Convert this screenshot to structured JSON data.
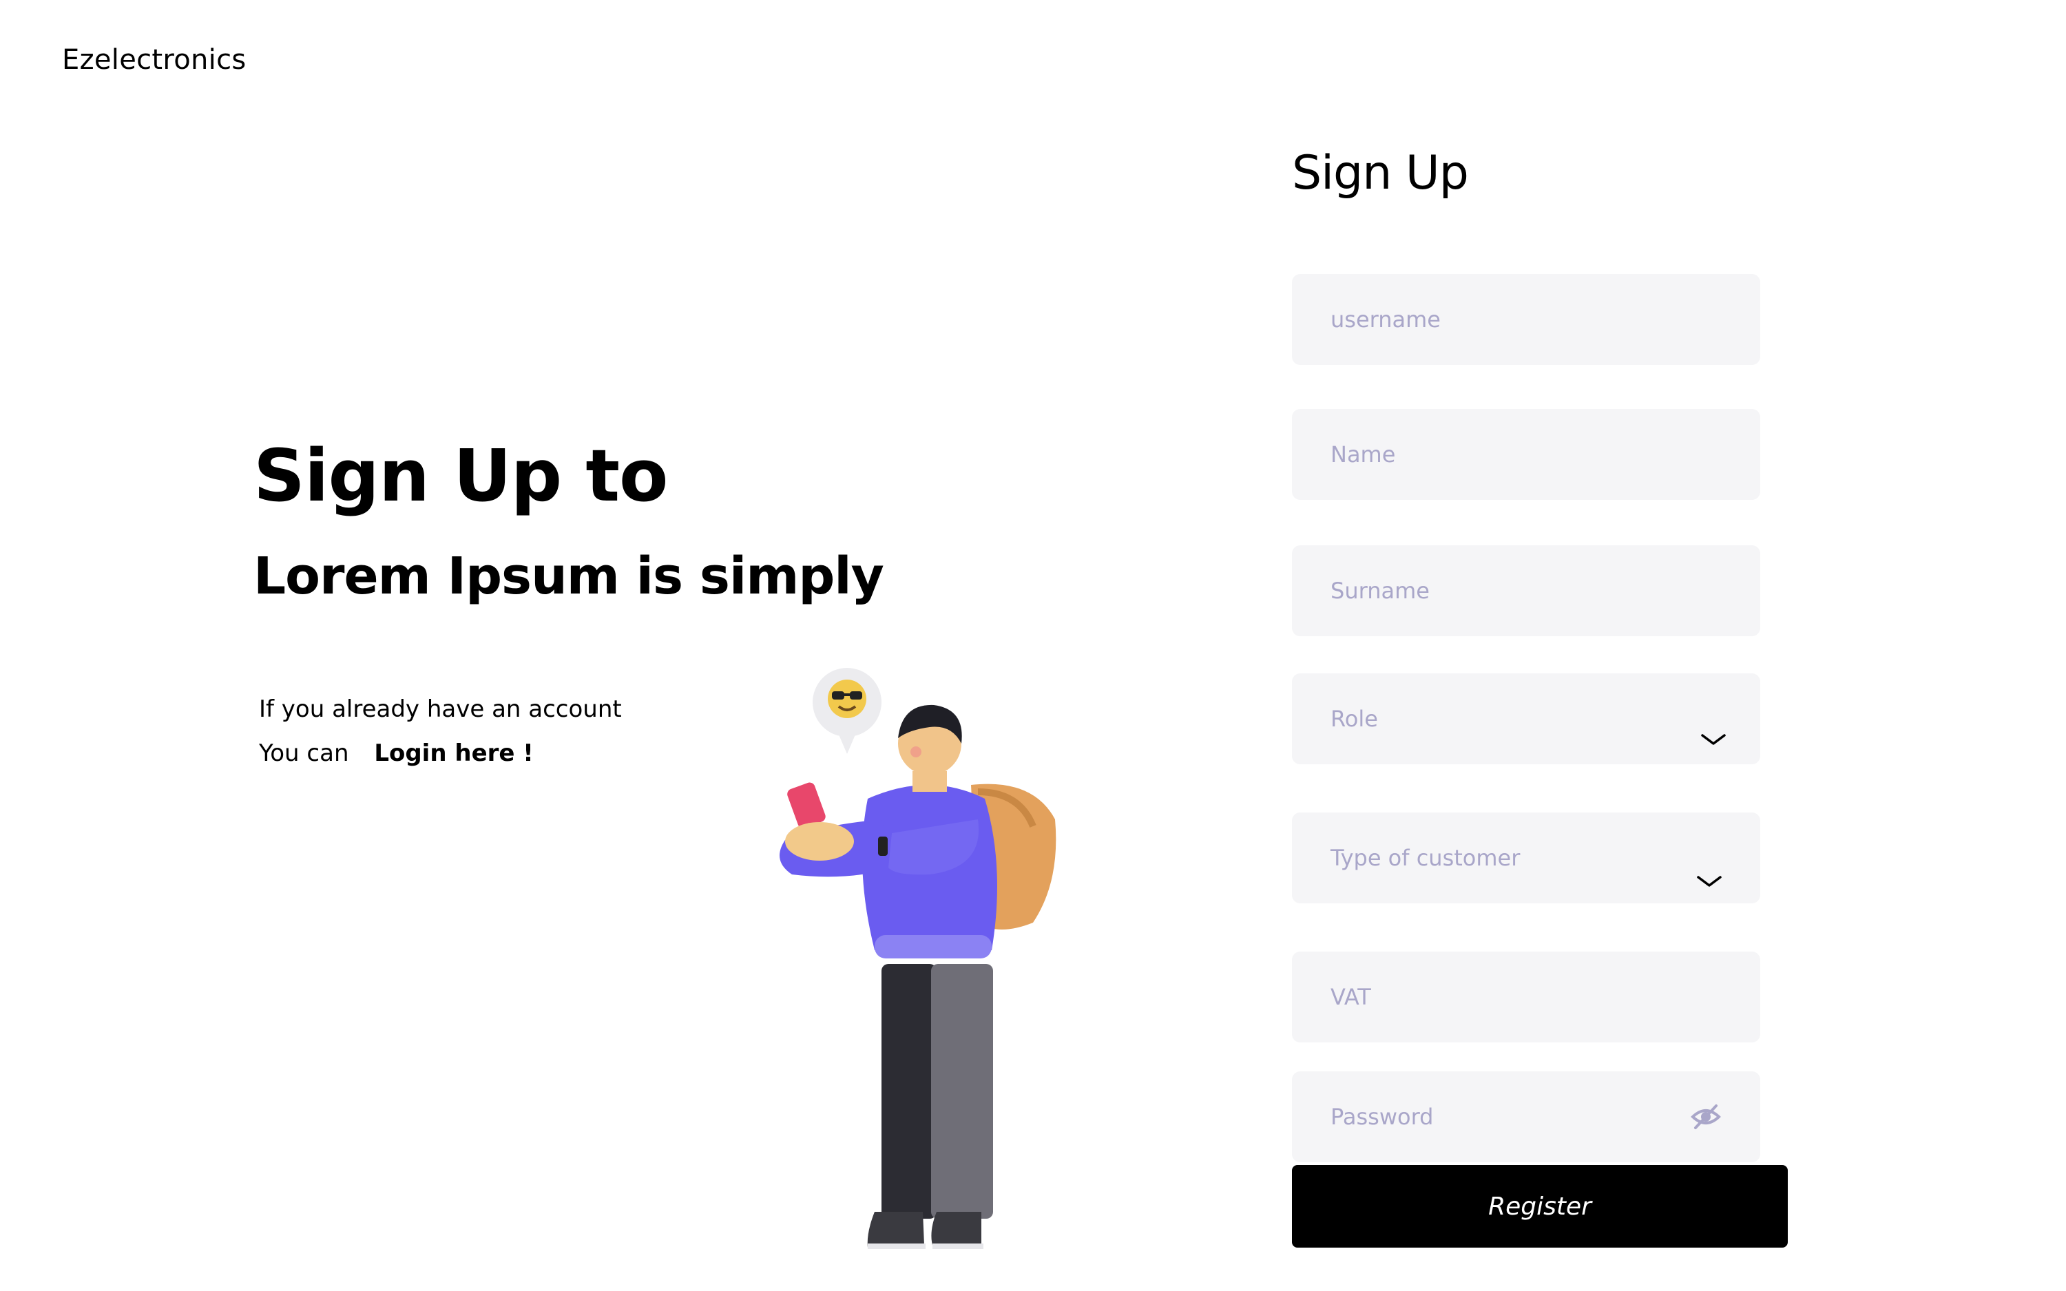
{
  "header": {
    "brand": "Ezelectronics"
  },
  "hero": {
    "title": "Sign Up to",
    "subtitle": "Lorem Ipsum is simply",
    "hint_line1": "If you already have an account",
    "hint_prefix": "You can",
    "login_link": "Login here !"
  },
  "form": {
    "title": "Sign Up",
    "username_placeholder": "username",
    "name_placeholder": "Name",
    "surname_placeholder": "Surname",
    "role_placeholder": "Role",
    "customer_type_placeholder": "Type of customer",
    "vat_placeholder": "VAT",
    "password_placeholder": "Password",
    "register_label": "Register"
  },
  "icons": {
    "role_dropdown": "chevron-down-icon",
    "customer_type_dropdown": "chevron-down-icon",
    "password_toggle": "eye-off-icon"
  },
  "colors": {
    "field_background": "#f5f5f7",
    "placeholder": "#a9a6c9",
    "button_background": "#000000",
    "button_text": "#ffffff"
  }
}
